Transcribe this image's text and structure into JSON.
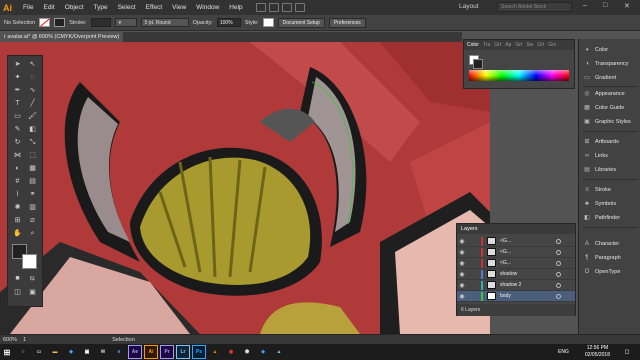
{
  "app": {
    "logo": "Ai"
  },
  "menu": [
    "File",
    "Edit",
    "Object",
    "Type",
    "Select",
    "Effect",
    "View",
    "Window",
    "Help"
  ],
  "workspace": {
    "label": "Layout",
    "search_placeholder": "Search Adobe Stock"
  },
  "control": {
    "selection": "No Selection",
    "stroke_label": "Stroke:",
    "brush": "5 pt. Round",
    "opacity_label": "Opacity:",
    "opacity_value": "100%",
    "style_label": "Style:",
    "doc_setup": "Document Setup",
    "preferences": "Preferences"
  },
  "doc_tab": "r avatar.ai* @ 600% (CMYK/Overprint Preview)",
  "color_panel": {
    "tabs": [
      "Color",
      "Tra",
      "Grt",
      "Ap",
      "Grt",
      "Sw",
      "Grt",
      "Grc"
    ],
    "active": "Color"
  },
  "right_panel": [
    {
      "label": "Color",
      "icon": "color-icon"
    },
    {
      "label": "Transparency",
      "icon": "transparency-icon"
    },
    {
      "label": "Gradient",
      "icon": "gradient-icon"
    },
    {
      "label": "Appearance",
      "icon": "appearance-icon"
    },
    {
      "label": "Color Guide",
      "icon": "color-guide-icon"
    },
    {
      "label": "Graphic Styles",
      "icon": "graphic-styles-icon"
    },
    {
      "label": "Artboards",
      "icon": "artboards-icon"
    },
    {
      "label": "Links",
      "icon": "links-icon"
    },
    {
      "label": "Libraries",
      "icon": "libraries-icon"
    },
    {
      "label": "Stroke",
      "icon": "stroke-icon"
    },
    {
      "label": "Symbols",
      "icon": "symbols-icon"
    },
    {
      "label": "Pathfinder",
      "icon": "pathfinder-icon"
    },
    {
      "label": "Character",
      "icon": "character-icon"
    },
    {
      "label": "Paragraph",
      "icon": "paragraph-icon"
    },
    {
      "label": "OpenType",
      "icon": "opentype-icon"
    }
  ],
  "layers": {
    "title": "Layers",
    "rows": [
      {
        "name": "<G...",
        "color": "#d03030",
        "selected": false
      },
      {
        "name": "<G...",
        "color": "#d03030",
        "selected": false
      },
      {
        "name": "<G...",
        "color": "#d03030",
        "selected": false
      },
      {
        "name": "shadow",
        "color": "#4a7bd0",
        "selected": false
      },
      {
        "name": "shadow 2",
        "color": "#2eb0b0",
        "selected": false
      },
      {
        "name": "body",
        "color": "#3ec33e",
        "selected": true
      }
    ],
    "footer": "6 Layers"
  },
  "status": {
    "zoom": "600%",
    "page": "1",
    "tool": "Selection"
  },
  "taskbar": {
    "apps": [
      {
        "icon": "ae-icon",
        "label": "Ae",
        "color": "#1f0740",
        "text": "#9b9bff"
      },
      {
        "icon": "ai-icon",
        "label": "Ai",
        "color": "#2e1a00",
        "text": "#ff9a00"
      },
      {
        "icon": "pr-icon",
        "label": "Pr",
        "color": "#1f0740",
        "text": "#9b9bff"
      },
      {
        "icon": "lr-icon",
        "label": "Lr",
        "color": "#0e2738",
        "text": "#7ec6ff"
      },
      {
        "icon": "ps-icon",
        "label": "Ps",
        "color": "#001d34",
        "text": "#31a8ff"
      }
    ],
    "lang": "ENG",
    "time": "12:56 PM",
    "date": "02/05/2018"
  },
  "colors": {
    "canvas_red": "#b03a3a",
    "accent": "#ff9a00"
  }
}
